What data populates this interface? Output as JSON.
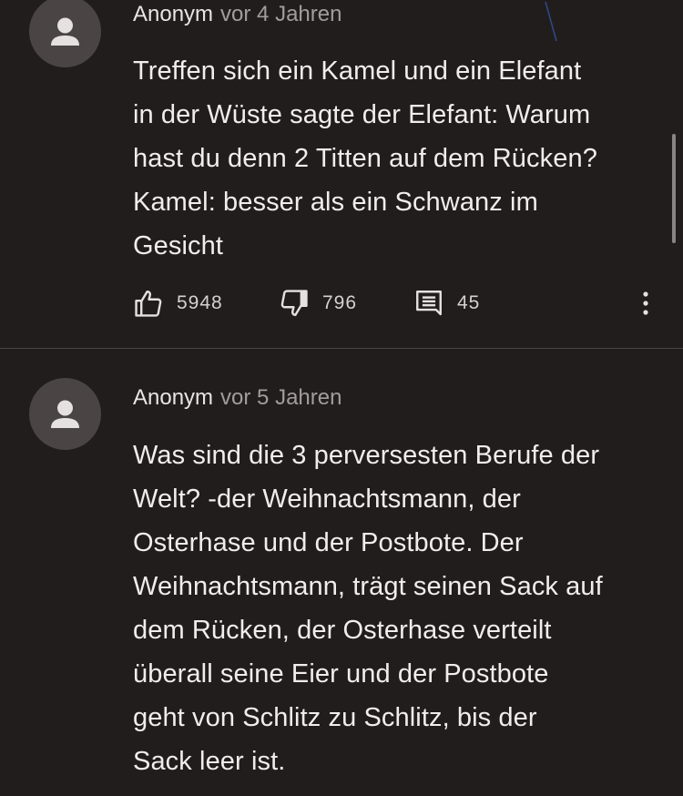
{
  "comments": [
    {
      "author": "Anonym",
      "time": "vor 4 Jahren",
      "lines": [
        "Treffen sich ein Kamel und ein Elefant",
        "in der Wüste sagte der Elefant: Warum",
        "hast du denn 2 Titten auf dem Rücken?",
        "Kamel: besser als ein Schwanz im",
        "Gesicht"
      ],
      "likes": "5948",
      "dislikes": "796",
      "replies": "45",
      "icons": [
        "avatar-person-icon",
        "thumbs-up-icon",
        "thumbs-down-icon",
        "comment-icon",
        "more-vert-icon"
      ]
    },
    {
      "author": "Anonym",
      "time": "vor 5 Jahren",
      "lines": [
        "Was sind die 3 perversesten Berufe der",
        "Welt? -der Weihnachtsmann, der",
        "Osterhase und der Postbote. Der",
        "Weihnachtsmann, trägt seinen Sack auf",
        "dem Rücken, der Osterhase verteilt",
        "überall seine Eier und der Postbote",
        "geht von Schlitz zu Schlitz, bis der",
        "Sack leer ist."
      ],
      "icons": [
        "avatar-person-icon"
      ]
    }
  ],
  "colors": {
    "background": "#221d1d",
    "avatar": "#4a4444",
    "text": "#f1eded",
    "muted": "#a39c9c"
  }
}
